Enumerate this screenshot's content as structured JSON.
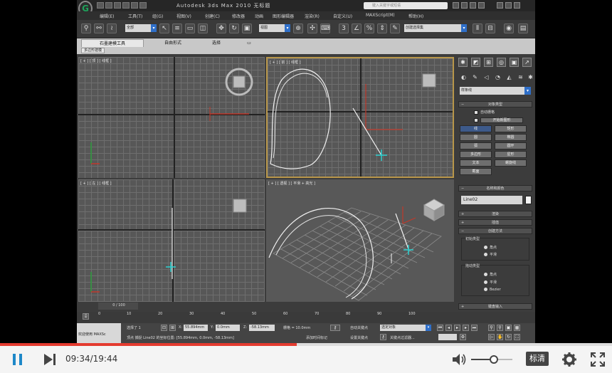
{
  "app": {
    "title": "Autodesk 3ds Max  2010    无标题",
    "search_placeholder": "键入关键字或短语",
    "logo": "G",
    "menus": [
      "编辑(E)",
      "工具(T)",
      "组(G)",
      "视图(V)",
      "创建(C)",
      "修改器",
      "动画",
      "图形编辑器",
      "渲染(R)",
      "自定义(U)",
      "MAXScript(M)",
      "帮助(H)"
    ],
    "toolbar": {
      "selection_filter": "全部",
      "ref_coord": "视图",
      "named_selection": "创建选择集"
    },
    "ribbon": {
      "tabs": [
        "石墨建模工具",
        "自由形式",
        "选择",
        "▭"
      ],
      "subtab": "多边形建模"
    }
  },
  "viewports": [
    {
      "label": "[ + ] [ 顶 ] [ 线框 ]"
    },
    {
      "label": "[ + ] [ 前 ] [ 线框 ]"
    },
    {
      "label": "[ + ] [ 左 ] [ 线框 ]"
    },
    {
      "label": "[ + ] [ 透视 ] [ 平滑 + 高光 ]"
    }
  ],
  "panel": {
    "category": "样条线",
    "object_type_title": "对象类型",
    "auto_grid": "自动栅格",
    "start_new_shape": "开始新图形",
    "buttons": [
      "线",
      "矩形",
      "圆",
      "椭圆",
      "弧",
      "圆环",
      "多边形",
      "星形",
      "文本",
      "螺旋线",
      "截面"
    ],
    "name_color_title": "名称和颜色",
    "object_name": "Line02",
    "rollouts": [
      "渲染",
      "插值",
      "创建方法"
    ],
    "initial_type_title": "初始类型",
    "initial_type_options": [
      "角点",
      "平滑"
    ],
    "drag_type_title": "拖动类型",
    "drag_type_options": [
      "角点",
      "平滑",
      "Bezier"
    ],
    "keyboard_entry": "键盘输入"
  },
  "timeline": {
    "frame_display": "0 / 100",
    "ticks": [
      "0",
      "10",
      "20",
      "30",
      "40",
      "50",
      "60",
      "70",
      "80",
      "90",
      "100"
    ]
  },
  "statusbar": {
    "welcome": "欢迎使用 MAXSc",
    "selected": "选择了 1",
    "x_label": "X:",
    "x_value": "55.894mm",
    "y_label": "Y:",
    "y_value": "0.0mm",
    "z_label": "Z:",
    "z_value": "-58.13mm",
    "grid": "栅格 = 10.0mm",
    "prompt": "顶点 捕捉 Line02 的坐标位置: [55.894mm, 0.0mm, -58.13mm]",
    "add_time_tag": "添加时间标记",
    "auto_key": "自动关键点",
    "selected_object": "选定对象",
    "set_key": "设置关键点",
    "key_filters": "关键点过滤器..."
  },
  "player": {
    "current_time": "09:34",
    "total_time": "19:44",
    "time_display": "09:34/19:44",
    "quality": "标清",
    "progress_fraction": 0.485,
    "volume_fraction": 0.55,
    "accent_color": "#e43b2f"
  }
}
